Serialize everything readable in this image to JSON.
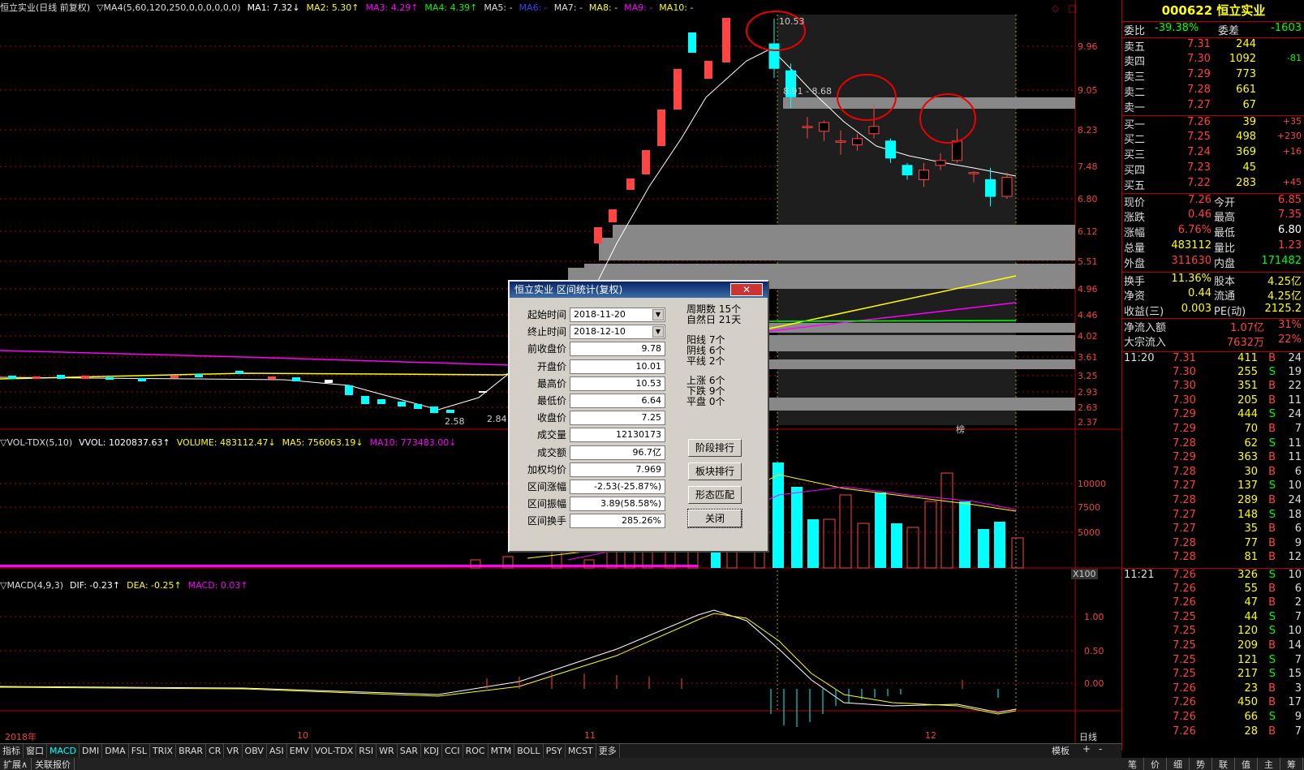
{
  "chart_title": "恒立实业(日线 前复权)",
  "ma_header": [
    {
      "t": "▽MA4(5,60,120,250,0,0,0,0,0,0)",
      "c": "#dddddd"
    },
    {
      "t": "MA1: 7.32↓",
      "c": "#ffffff"
    },
    {
      "t": "MA2: 5.30↑",
      "c": "#ffff00"
    },
    {
      "t": "MA3: 4.29↑",
      "c": "#ff00ff"
    },
    {
      "t": "MA4: 4.39↑",
      "c": "#00ff00"
    },
    {
      "t": "MA5: -",
      "c": "#dddddd"
    },
    {
      "t": "MA6: -",
      "c": "#4040ff"
    },
    {
      "t": "MA7: -",
      "c": "#dddddd"
    },
    {
      "t": "MA8: -",
      "c": "#ffff00"
    },
    {
      "t": "MA9: -",
      "c": "#ff00ff"
    },
    {
      "t": "MA10: -",
      "c": "#ffff00"
    }
  ],
  "vol_header": [
    {
      "t": "▽VOL-TDX(5,10)",
      "c": "#dddddd"
    },
    {
      "t": "VVOL: 1020837.63↑",
      "c": "#ffffff"
    },
    {
      "t": "VOLUME: 483112.47↓",
      "c": "#ffff00"
    },
    {
      "t": "MA5: 756063.19↓",
      "c": "#ffff00"
    },
    {
      "t": "MA10: 773483.00↓",
      "c": "#ff00ff"
    }
  ],
  "macd_header": [
    {
      "t": "▽MACD(4,9,3)",
      "c": "#dddddd"
    },
    {
      "t": "DIF: -0.23↑",
      "c": "#ffffff"
    },
    {
      "t": "DEA: -0.25↑",
      "c": "#ffff00"
    },
    {
      "t": "MACD: 0.03↑",
      "c": "#ff00ff"
    }
  ],
  "price_scale": [
    "9.96",
    "9.05",
    "8.23",
    "7.48",
    "6.80",
    "6.12",
    "5.51",
    "4.96",
    "4.46",
    "4.02",
    "3.61",
    "3.25",
    "2.93",
    "2.63",
    "2.37"
  ],
  "vol_scale": [
    "10000",
    "7500",
    "5000"
  ],
  "vol_unit": "X100",
  "macd_scale": [
    "1.00",
    "0.50",
    "0.00"
  ],
  "date_axis": [
    "2018年",
    "10",
    "11",
    "12"
  ],
  "period_label": "日线",
  "annotations": {
    "high": "10.53",
    "low": "2.58",
    "low_right": "2.84",
    "range": "8.91 - 8.68",
    "mark": "榜"
  },
  "indicator_tabs": [
    "指标",
    "窗口",
    "MACD",
    "DMI",
    "DMA",
    "FSL",
    "TRIX",
    "BRAR",
    "CR",
    "VR",
    "OBV",
    "ASI",
    "EMV",
    "VOL-TDX",
    "RSI",
    "WR",
    "SAR",
    "KDJ",
    "CCI",
    "ROC",
    "MTM",
    "BOLL",
    "PSY",
    "MCST",
    "更多"
  ],
  "template_label": "模板",
  "bottom_tabs": [
    "扩展∧",
    "关联报价"
  ],
  "right_tabs": [
    "笔",
    "价",
    "细",
    "势",
    "联",
    "值",
    "主",
    "筹"
  ],
  "dialog": {
    "title": "恒立实业 区间统计(复权)",
    "close": "✕",
    "fields": [
      {
        "label": "起始时间",
        "value": "2018-11-20"
      },
      {
        "label": "终止时间",
        "value": "2018-12-10"
      },
      {
        "label": "前收盘价",
        "value": "9.78"
      },
      {
        "label": "开盘价",
        "value": "10.01"
      },
      {
        "label": "最高价",
        "value": "10.53"
      },
      {
        "label": "最低价",
        "value": "6.64"
      },
      {
        "label": "收盘价",
        "value": "7.25"
      },
      {
        "label": "成交量",
        "value": "12130173"
      },
      {
        "label": "成交额",
        "value": "96.7亿"
      },
      {
        "label": "加权均价",
        "value": "7.969"
      },
      {
        "label": "区间涨幅",
        "value": "-2.53(-25.87%)"
      },
      {
        "label": "区间振幅",
        "value": "3.89(58.58%)"
      },
      {
        "label": "区间换手",
        "value": "285.26%"
      }
    ],
    "stats": [
      {
        "k": "周期数",
        "v": "15个"
      },
      {
        "k": "自然日",
        "v": "21天"
      },
      {
        "k": "阳线",
        "v": "7个"
      },
      {
        "k": "阴线",
        "v": "6个"
      },
      {
        "k": "平线",
        "v": "2个"
      },
      {
        "k": "上涨",
        "v": "6个"
      },
      {
        "k": "下跌",
        "v": "9个"
      },
      {
        "k": "平盘",
        "v": "0个"
      }
    ],
    "buttons": [
      "阶段排行",
      "板块排行",
      "形态匹配",
      "关闭"
    ]
  },
  "quote": {
    "code_name": "000622 恒立实业",
    "weibi_label": "委比",
    "weibi": "-39.38%",
    "weicha_label": "委差",
    "weicha": "-1603",
    "asks": [
      {
        "l": "卖五",
        "p": "7.31",
        "v": "244",
        "d": ""
      },
      {
        "l": "卖四",
        "p": "7.30",
        "v": "1092",
        "d": "-81"
      },
      {
        "l": "卖三",
        "p": "7.29",
        "v": "773",
        "d": ""
      },
      {
        "l": "卖二",
        "p": "7.28",
        "v": "661",
        "d": ""
      },
      {
        "l": "卖一",
        "p": "7.27",
        "v": "67",
        "d": ""
      }
    ],
    "bids": [
      {
        "l": "买一",
        "p": "7.26",
        "v": "39",
        "d": "+35"
      },
      {
        "l": "买二",
        "p": "7.25",
        "v": "498",
        "d": "+230"
      },
      {
        "l": "买三",
        "p": "7.24",
        "v": "369",
        "d": "+16"
      },
      {
        "l": "买四",
        "p": "7.23",
        "v": "45",
        "d": ""
      },
      {
        "l": "买五",
        "p": "7.22",
        "v": "283",
        "d": "+45"
      }
    ],
    "stats": [
      {
        "a": "现价",
        "av": "7.26",
        "b": "今开",
        "bv": "6.85",
        "ac": "#ff4040",
        "bc": "#ff4040"
      },
      {
        "a": "涨跌",
        "av": "0.46",
        "b": "最高",
        "bv": "7.35",
        "ac": "#ff4040",
        "bc": "#ff4040"
      },
      {
        "a": "涨幅",
        "av": "6.76%",
        "b": "最低",
        "bv": "6.80",
        "ac": "#ff4040",
        "bc": "#ffffff"
      },
      {
        "a": "总量",
        "av": "483112",
        "b": "量比",
        "bv": "1.23",
        "ac": "#ffff00",
        "bc": "#ff4040"
      },
      {
        "a": "外盘",
        "av": "311630",
        "b": "内盘",
        "bv": "171482",
        "ac": "#ff4040",
        "bc": "#00ff00"
      },
      {
        "a": "换手",
        "av": "11.36%",
        "b": "股本",
        "bv": "4.25亿",
        "ac": "#ffff00",
        "bc": "#ffff00"
      },
      {
        "a": "净资",
        "av": "0.44",
        "b": "流通",
        "bv": "4.25亿",
        "ac": "#ffff00",
        "bc": "#ffff00"
      },
      {
        "a": "收益(三)",
        "av": "0.003",
        "b": "PE(动)",
        "bv": "2125.2",
        "ac": "#ffff00",
        "bc": "#ffff00"
      }
    ],
    "flows": [
      {
        "l": "净流入额",
        "v": "1.07亿",
        "p": "31%"
      },
      {
        "l": "大宗流入",
        "v": "7632万",
        "p": "22%"
      }
    ],
    "ticks": [
      {
        "t": "11:20",
        "p": "7.31",
        "v": "411",
        "s": "B",
        "n": "24"
      },
      {
        "t": "",
        "p": "7.30",
        "v": "255",
        "s": "S",
        "n": "19"
      },
      {
        "t": "",
        "p": "7.30",
        "v": "351",
        "s": "B",
        "n": "22"
      },
      {
        "t": "",
        "p": "7.30",
        "v": "205",
        "s": "B",
        "n": "11"
      },
      {
        "t": "",
        "p": "7.29",
        "v": "444",
        "s": "S",
        "n": "24"
      },
      {
        "t": "",
        "p": "7.29",
        "v": "70",
        "s": "B",
        "n": "7"
      },
      {
        "t": "",
        "p": "7.28",
        "v": "62",
        "s": "S",
        "n": "11"
      },
      {
        "t": "",
        "p": "7.29",
        "v": "363",
        "s": "B",
        "n": "11"
      },
      {
        "t": "",
        "p": "7.28",
        "v": "30",
        "s": "B",
        "n": "6"
      },
      {
        "t": "",
        "p": "7.27",
        "v": "137",
        "s": "S",
        "n": "10"
      },
      {
        "t": "",
        "p": "7.28",
        "v": "289",
        "s": "B",
        "n": "24"
      },
      {
        "t": "",
        "p": "7.27",
        "v": "148",
        "s": "S",
        "n": "18"
      },
      {
        "t": "",
        "p": "7.27",
        "v": "35",
        "s": "B",
        "n": "6"
      },
      {
        "t": "",
        "p": "7.28",
        "v": "77",
        "s": "B",
        "n": "9"
      },
      {
        "t": "",
        "p": "7.28",
        "v": "81",
        "s": "B",
        "n": "12"
      },
      {
        "t": "11:21",
        "p": "7.26",
        "v": "326",
        "s": "S",
        "n": "10"
      },
      {
        "t": "",
        "p": "7.26",
        "v": "55",
        "s": "B",
        "n": "6"
      },
      {
        "t": "",
        "p": "7.26",
        "v": "47",
        "s": "B",
        "n": "2"
      },
      {
        "t": "",
        "p": "7.25",
        "v": "44",
        "s": "S",
        "n": "7"
      },
      {
        "t": "",
        "p": "7.25",
        "v": "120",
        "s": "S",
        "n": "10"
      },
      {
        "t": "",
        "p": "7.25",
        "v": "209",
        "s": "B",
        "n": "14"
      },
      {
        "t": "",
        "p": "7.25",
        "v": "121",
        "s": "S",
        "n": "7"
      },
      {
        "t": "",
        "p": "7.25",
        "v": "217",
        "s": "S",
        "n": "15"
      },
      {
        "t": "",
        "p": "7.26",
        "v": "23",
        "s": "B",
        "n": "3"
      },
      {
        "t": "",
        "p": "7.26",
        "v": "450",
        "s": "B",
        "n": "17"
      },
      {
        "t": "",
        "p": "7.26",
        "v": "66",
        "s": "S",
        "n": "9"
      },
      {
        "t": "",
        "p": "7.26",
        "v": "28",
        "s": "B",
        "n": "7"
      }
    ]
  },
  "chart_data": {
    "type": "candlestick",
    "title": "恒立实业(日线 前复权)",
    "price_range": [
      2.37,
      10.53
    ],
    "candles": [
      {
        "d": "2018-11-20",
        "o": 10.01,
        "h": 10.53,
        "l": 9.3,
        "c": 9.5
      },
      {
        "d": "2018-11-21",
        "o": 9.45,
        "h": 9.6,
        "l": 8.68,
        "c": 8.91
      },
      {
        "d": "2018-11-22",
        "o": 8.3,
        "h": 8.5,
        "l": 8.05,
        "c": 8.3
      },
      {
        "d": "2018-11-23",
        "o": 8.2,
        "h": 8.42,
        "l": 8.0,
        "c": 8.38
      },
      {
        "d": "2018-11-26",
        "o": 8.0,
        "h": 8.22,
        "l": 7.72,
        "c": 8.0
      },
      {
        "d": "2018-11-27",
        "o": 7.92,
        "h": 8.15,
        "l": 7.8,
        "c": 8.05
      },
      {
        "d": "2018-11-28",
        "o": 8.15,
        "h": 8.75,
        "l": 8.05,
        "c": 8.3
      },
      {
        "d": "2018-11-29",
        "o": 8.0,
        "h": 8.05,
        "l": 7.55,
        "c": 7.65
      },
      {
        "d": "2018-11-30",
        "o": 7.5,
        "h": 7.55,
        "l": 7.2,
        "c": 7.3
      },
      {
        "d": "2018-12-03",
        "o": 7.2,
        "h": 7.55,
        "l": 7.05,
        "c": 7.4
      },
      {
        "d": "2018-12-04",
        "o": 7.5,
        "h": 7.75,
        "l": 7.4,
        "c": 7.6
      },
      {
        "d": "2018-12-05",
        "o": 7.6,
        "h": 8.25,
        "l": 7.55,
        "c": 8.0
      },
      {
        "d": "2018-12-06",
        "o": 7.35,
        "h": 7.38,
        "l": 7.15,
        "c": 7.35
      },
      {
        "d": "2018-12-07",
        "o": 7.2,
        "h": 7.45,
        "l": 6.64,
        "c": 6.85
      },
      {
        "d": "2018-12-10",
        "o": 6.85,
        "h": 7.35,
        "l": 6.8,
        "c": 7.25
      }
    ]
  }
}
